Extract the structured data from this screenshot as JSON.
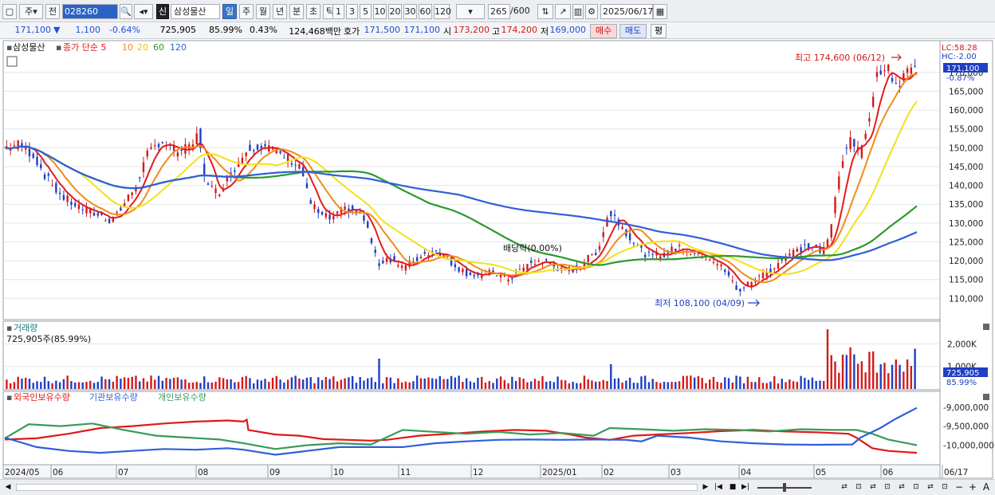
{
  "toolbar": {
    "period_type": "주",
    "prev_label": "전",
    "code": "028260",
    "new_badge": "신",
    "stock_name": "삼성물산",
    "periods": [
      "일",
      "주",
      "월",
      "년",
      "분",
      "초",
      "틱"
    ],
    "active_period": "일",
    "intervals": [
      "1",
      "3",
      "5",
      "10",
      "20",
      "30",
      "60",
      "120"
    ],
    "count": "265",
    "total": "/600",
    "date": "2025/06/17"
  },
  "info": {
    "price": "171,100",
    "down_arrow": "▼",
    "change": "1,100",
    "change_pct": "-0.64%",
    "volume": "725,905",
    "vol_ratio": "85.99%",
    "turnover": "0.43%",
    "amount": "124,468백만",
    "bid_label": "호가",
    "ask": "171,500",
    "bid": "171,100",
    "open_label": "시",
    "open": "173,200",
    "high_label": "고",
    "high": "174,200",
    "low_label": "저",
    "low": "169,000",
    "buy_label": "매수",
    "sell_label": "매도",
    "avg_label": "평"
  },
  "legend": {
    "name": "삼성물산",
    "ma_title": "종가 단순 5",
    "ma10": "10",
    "ma20": "20",
    "ma60": "60",
    "ma120": "120"
  },
  "chart_labels": {
    "lc": "LC:58.28",
    "hc": "HC:-2.00",
    "current_price": "171,100",
    "current_pct": "-0.87%",
    "high_marker": "최고 174,600 (06/12)",
    "low_marker": "최저 108,100 (04/09)",
    "dividend": "배당락(0.00%)",
    "volume_title": "거래량",
    "volume_value": "725,905주(85.99%)",
    "volume_current": "725,905",
    "volume_pct": "85.99%",
    "holdings_foreign": "외국인보유수량",
    "holdings_inst": "기관보유수량",
    "holdings_indiv": "개인보유수량"
  },
  "colors": {
    "up": "#d31a1a",
    "down": "#1f3fc4",
    "ma5": "#e31b1b",
    "ma10": "#f08c1a",
    "ma20": "#f2e11a",
    "ma60": "#2a9a2a",
    "ma120": "#2f5fd8",
    "foreign": "#e01818",
    "inst": "#3a9a5a",
    "indiv": "#2f5fd8"
  },
  "chart_data": [
    {
      "type": "candlestick",
      "title": "삼성물산",
      "y_ticks": [
        110000,
        115000,
        120000,
        125000,
        130000,
        135000,
        140000,
        145000,
        150000,
        155000,
        160000,
        165000,
        170000
      ],
      "y_tick_labels": [
        "110,000",
        "115,000",
        "120,000",
        "125,000",
        "130,000",
        "135,000",
        "140,000",
        "145,000",
        "150,000",
        "155,000",
        "160,000",
        "165,000",
        "170,000"
      ],
      "ylim": [
        105000,
        178000
      ],
      "x_tick_labels": [
        "2024/05",
        "06",
        "07",
        "08",
        "09",
        "10",
        "11",
        "12",
        "2025/01",
        "02",
        "03",
        "04",
        "05",
        "06",
        "06/17"
      ],
      "close_path": [
        [
          0,
          150000
        ],
        [
          8,
          151000
        ],
        [
          15,
          148000
        ],
        [
          22,
          142000
        ],
        [
          30,
          137000
        ],
        [
          40,
          134000
        ],
        [
          50,
          132000
        ],
        [
          55,
          131000
        ],
        [
          60,
          133000
        ],
        [
          68,
          139000
        ],
        [
          75,
          148000
        ],
        [
          82,
          152000
        ],
        [
          90,
          149000
        ],
        [
          98,
          150000
        ],
        [
          102,
          154000
        ],
        [
          106,
          140000
        ],
        [
          112,
          138000
        ],
        [
          120,
          144000
        ],
        [
          128,
          150000
        ],
        [
          136,
          151000
        ],
        [
          142,
          149000
        ],
        [
          150,
          147000
        ],
        [
          156,
          145000
        ],
        [
          160,
          136000
        ],
        [
          166,
          132000
        ],
        [
          172,
          131000
        ],
        [
          180,
          134000
        ],
        [
          188,
          132000
        ],
        [
          192,
          127000
        ],
        [
          196,
          119000
        ],
        [
          202,
          121000
        ],
        [
          210,
          118000
        ],
        [
          218,
          121000
        ],
        [
          226,
          123000
        ],
        [
          234,
          120000
        ],
        [
          242,
          117000
        ],
        [
          250,
          116000
        ],
        [
          258,
          117000
        ],
        [
          264,
          115000
        ],
        [
          270,
          117000
        ],
        [
          276,
          119000
        ],
        [
          282,
          120000
        ],
        [
          288,
          119000
        ],
        [
          294,
          117000
        ],
        [
          300,
          118000
        ],
        [
          306,
          120000
        ],
        [
          312,
          123000
        ],
        [
          318,
          133000
        ],
        [
          322,
          131000
        ],
        [
          328,
          127000
        ],
        [
          334,
          123000
        ],
        [
          340,
          121000
        ],
        [
          348,
          122000
        ],
        [
          356,
          124000
        ],
        [
          362,
          122000
        ],
        [
          370,
          121000
        ],
        [
          376,
          119000
        ],
        [
          382,
          115000
        ],
        [
          386,
          112000
        ],
        [
          392,
          114000
        ],
        [
          398,
          116000
        ],
        [
          404,
          118000
        ],
        [
          410,
          121000
        ],
        [
          418,
          123000
        ],
        [
          424,
          124000
        ],
        [
          430,
          122000
        ],
        [
          434,
          126000
        ],
        [
          438,
          140000
        ],
        [
          442,
          150000
        ],
        [
          446,
          152000
        ],
        [
          450,
          148000
        ],
        [
          454,
          156000
        ],
        [
          458,
          168000
        ],
        [
          462,
          172000
        ],
        [
          466,
          170000
        ],
        [
          470,
          166000
        ],
        [
          474,
          171100
        ]
      ],
      "series_names": [
        "5",
        "10",
        "20",
        "60",
        "120"
      ]
    },
    {
      "type": "bar",
      "title": "거래량",
      "y_tick_labels": [
        "1,000K",
        "2,000K"
      ],
      "y_ticks": [
        1000,
        2000
      ],
      "ylim": [
        0,
        2900
      ],
      "unit": "K"
    },
    {
      "type": "line",
      "series": [
        {
          "name": "외국인보유수량"
        },
        {
          "name": "기관보유수량"
        },
        {
          "name": "개인보유수량"
        }
      ],
      "y_tick_labels": [
        "-9,000,000",
        "-9,500,000",
        "-10,000,000"
      ],
      "y_ticks": [
        -9000000,
        -9500000,
        -10000000
      ],
      "ylim": [
        -10450000,
        -8900000
      ]
    }
  ],
  "scrollbar": {
    "left_arrow": "◀",
    "right_arrow": "▶",
    "zoom_out": "−",
    "zoom_in": "+",
    "font_a": "A"
  }
}
